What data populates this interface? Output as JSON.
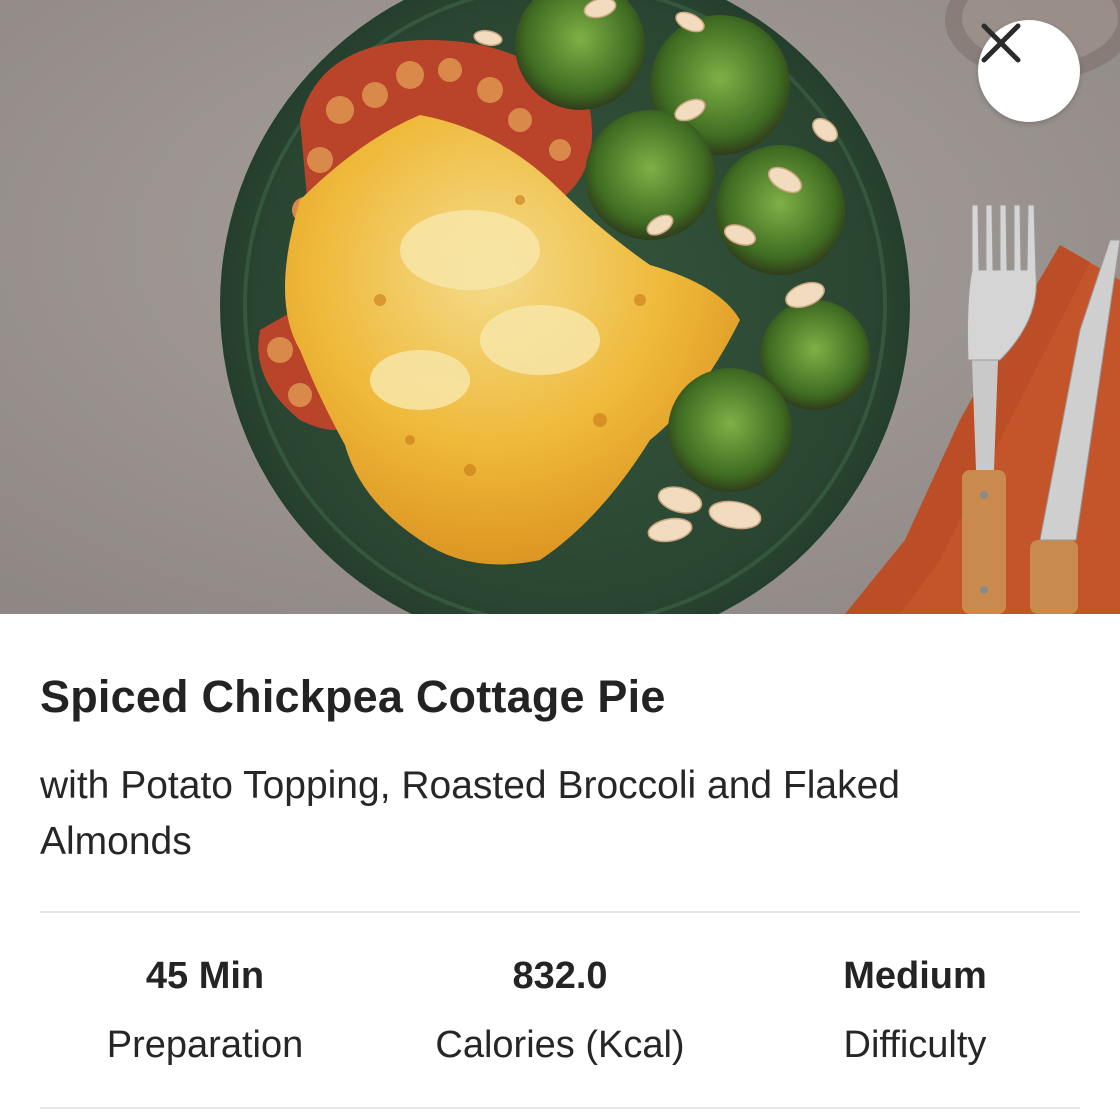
{
  "header": {
    "close_icon": "close-icon"
  },
  "recipe": {
    "title": "Spiced Chickpea Cottage Pie",
    "subtitle": "with Potato Topping, Roasted Broccoli and Flaked Almonds"
  },
  "stats": [
    {
      "value": "45 Min",
      "label": "Preparation"
    },
    {
      "value": "832.0",
      "label": "Calories (Kcal)"
    },
    {
      "value": "Medium",
      "label": "Difficulty"
    }
  ],
  "colors": {
    "background_table": "#9b9490",
    "plate": "#2c4a33",
    "napkin": "#c4552a",
    "text": "#242424",
    "divider": "#e6e6e6"
  }
}
